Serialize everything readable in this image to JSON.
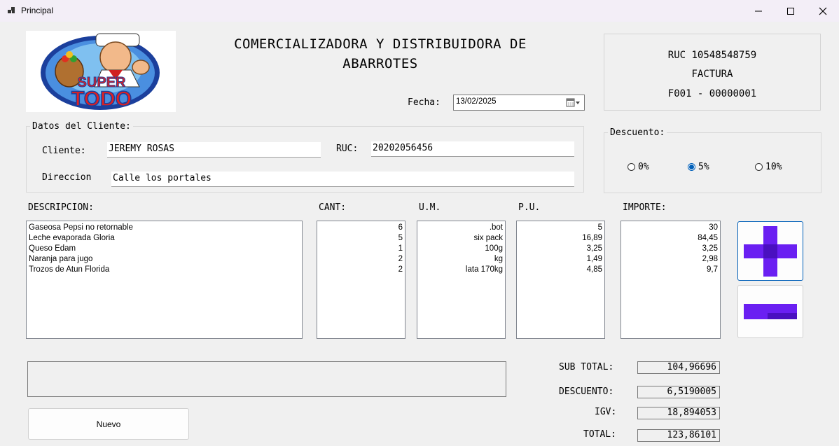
{
  "window": {
    "title": "Principal"
  },
  "logo": {
    "line1": "SUPER",
    "line2": "TODO"
  },
  "company": {
    "name": "COMERCIALIZADORA Y DISTRIBUIDORA DE ABARROTES"
  },
  "invoice": {
    "ruc_line": "RUC 10548548759",
    "type": "FACTURA",
    "number": "F001 - 00000001"
  },
  "date": {
    "label": "Fecha:",
    "value": "13/02/2025"
  },
  "client_group": {
    "legend": "Datos del Cliente:",
    "client_label": "Cliente:",
    "client_value": "JEREMY ROSAS",
    "ruc_label": "RUC:",
    "ruc_value": "20202056456",
    "address_label": "Direccion",
    "address_value": "Calle los portales"
  },
  "discount": {
    "legend": "Descuento:",
    "options": [
      "0%",
      "5%",
      "10%"
    ],
    "selected": "5%"
  },
  "columns": {
    "description": "DESCRIPCION:",
    "qty": "CANT:",
    "unit": "U.M.",
    "price": "P.U.",
    "amount": "IMPORTE:"
  },
  "items": {
    "description": [
      "Gaseosa Pepsi no retornable",
      "Leche evaporada Gloria",
      "Queso Edam",
      "Naranja para jugo",
      "Trozos de Atun Florida"
    ],
    "qty": [
      "6",
      "5",
      "1",
      "2",
      "2"
    ],
    "unit": [
      ".bot",
      "six pack",
      "100g",
      "kg",
      "lata 170kg"
    ],
    "price": [
      "5",
      "16,89",
      "3,25",
      "1,49",
      "4,85"
    ],
    "amount": [
      "30",
      "84,45",
      "3,25",
      "2,98",
      "9,7"
    ]
  },
  "buttons": {
    "add_icon": "plus-icon",
    "remove_icon": "minus-icon",
    "new_label": "Nuevo"
  },
  "totals": {
    "subtotal_label": "SUB TOTAL:",
    "subtotal_value": "104,96696",
    "discount_label": "DESCUENTO:",
    "discount_value": "6,5190005",
    "igv_label": "IGV:",
    "igv_value": "18,894053",
    "total_label": "TOTAL:",
    "total_value": "123,86101"
  },
  "colors": {
    "accent": "#6a1ff2",
    "accent_dark": "#4a10c0",
    "radio_selected": "#005fb8"
  }
}
